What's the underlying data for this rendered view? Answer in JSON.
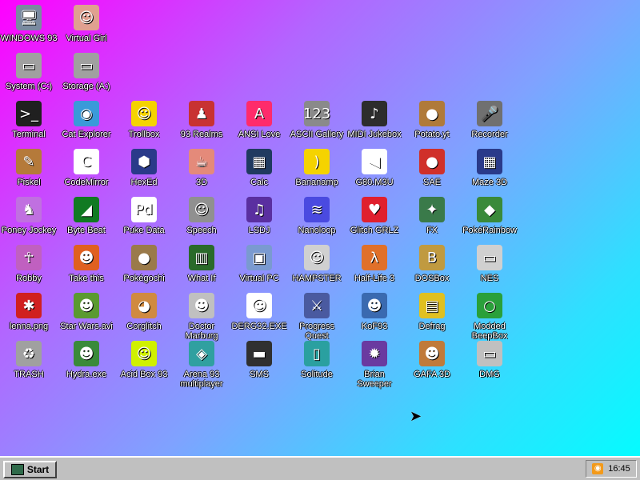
{
  "desktop": {
    "icons": [
      {
        "label": "WINDOWS 93",
        "glyph": "🖥",
        "color": "#7a8aa0"
      },
      {
        "label": "Virtual Girl",
        "glyph": "☺",
        "color": "#e0a090"
      },
      {
        "label": "System (C:)",
        "glyph": "▭",
        "color": "#a0a0a0"
      },
      {
        "label": "Storage (A:)",
        "glyph": "▭",
        "color": "#a0a0a0"
      },
      {
        "label": "Terminal",
        "glyph": ">_",
        "color": "#202020"
      },
      {
        "label": "Cat Explorer",
        "glyph": "◉",
        "color": "#3a9ad9"
      },
      {
        "label": "Trollbox",
        "glyph": "☺",
        "color": "#f5d300"
      },
      {
        "label": "93 Realms",
        "glyph": "♟",
        "color": "#c83232"
      },
      {
        "label": "ANSI Love",
        "glyph": "A",
        "color": "#ff2b6b"
      },
      {
        "label": "ASCII Gallery",
        "glyph": "123",
        "color": "#8a8a8a"
      },
      {
        "label": "MIDI Jukebox",
        "glyph": "♪",
        "color": "#2d2d2d"
      },
      {
        "label": "Potato.yt",
        "glyph": "●",
        "color": "#b07a3a"
      },
      {
        "label": "Recorder",
        "glyph": "🎤",
        "color": "#707070"
      },
      {
        "label": "Piskel",
        "glyph": "✎",
        "color": "#b57a3a"
      },
      {
        "label": "CodeMirror",
        "glyph": "C",
        "color": "#ffffff"
      },
      {
        "label": "HexEd",
        "glyph": "⬢",
        "color": "#2a3a8a"
      },
      {
        "label": "3D",
        "glyph": "☕",
        "color": "#e48a7a"
      },
      {
        "label": "Calc",
        "glyph": "▦",
        "color": "#203a60"
      },
      {
        "label": "Bananamp",
        "glyph": ")",
        "color": "#f5d300"
      },
      {
        "label": "G80.M3U",
        "glyph": "◀",
        "color": "#ffffff"
      },
      {
        "label": "SAE",
        "glyph": "●",
        "color": "#d0302a"
      },
      {
        "label": "Maze 3D",
        "glyph": "▦",
        "color": "#2a3a8a"
      },
      {
        "label": "Poney Jockey",
        "glyph": "♞",
        "color": "#c070e0"
      },
      {
        "label": "Byte Beat",
        "glyph": "◢",
        "color": "#117a22"
      },
      {
        "label": "Puke Data",
        "glyph": "Pd",
        "color": "#ffffff"
      },
      {
        "label": "Speech",
        "glyph": "☺",
        "color": "#909090"
      },
      {
        "label": "LSDJ",
        "glyph": "♫",
        "color": "#5a2fa0"
      },
      {
        "label": "Nanoloop",
        "glyph": "≋",
        "color": "#4a4ae0"
      },
      {
        "label": "Glitch GRLZ",
        "glyph": "♥",
        "color": "#e0202e"
      },
      {
        "label": "FX",
        "glyph": "✦",
        "color": "#3a7a4a"
      },
      {
        "label": "PokéRainbow",
        "glyph": "◆",
        "color": "#3a8a3a"
      },
      {
        "label": "Robby",
        "glyph": "☥",
        "color": "#c060c0"
      },
      {
        "label": "Take this",
        "glyph": "☻",
        "color": "#e06020"
      },
      {
        "label": "Pokégochi",
        "glyph": "●",
        "color": "#9a7a4a"
      },
      {
        "label": "What If",
        "glyph": "▥",
        "color": "#2a6a2a"
      },
      {
        "label": "Virtual PC",
        "glyph": "▣",
        "color": "#7a9ad0"
      },
      {
        "label": "HAMPSTER",
        "glyph": "☺",
        "color": "#d0d0d0"
      },
      {
        "label": "Half-Life 3",
        "glyph": "λ",
        "color": "#e0702a"
      },
      {
        "label": "DOSBox",
        "glyph": "B",
        "color": "#c09a40"
      },
      {
        "label": "NES",
        "glyph": "▭",
        "color": "#d0d0d0"
      },
      {
        "label": "lenna.png",
        "glyph": "✱",
        "color": "#d02020"
      },
      {
        "label": "Star Wars.avi",
        "glyph": "☻",
        "color": "#5a9a30"
      },
      {
        "label": "Corglitch",
        "glyph": "◕",
        "color": "#d08a40"
      },
      {
        "label": "Doctor Marburg",
        "glyph": "☻",
        "color": "#c0c0c0"
      },
      {
        "label": "DERG32.EXE",
        "glyph": "☺",
        "color": "#ffffff"
      },
      {
        "label": "Progress Quest",
        "glyph": "⚔",
        "color": "#4a5aa0"
      },
      {
        "label": "KoF93",
        "glyph": "☻",
        "color": "#3a6ab0"
      },
      {
        "label": "Defrag",
        "glyph": "▤",
        "color": "#e0c020"
      },
      {
        "label": "Modded BeepBox",
        "glyph": "○",
        "color": "#2aa03a"
      },
      {
        "label": "TRASH",
        "glyph": "♻",
        "color": "#a0a0a0"
      },
      {
        "label": "Hydra.exe",
        "glyph": "☻",
        "color": "#3a8a3a"
      },
      {
        "label": "Acid Box 93",
        "glyph": "☺",
        "color": "#d0f000"
      },
      {
        "label": "Arena 93 multiplayer",
        "glyph": "◈",
        "color": "#30a0a0"
      },
      {
        "label": "SMS",
        "glyph": "▬",
        "color": "#303030"
      },
      {
        "label": "Solitude",
        "glyph": "▯",
        "color": "#2aa0a0"
      },
      {
        "label": "Brian Sweeper",
        "glyph": "✹",
        "color": "#6a3aa0"
      },
      {
        "label": "GAFA 3D",
        "glyph": "☻",
        "color": "#c07a3a"
      },
      {
        "label": "DMG",
        "glyph": "▭",
        "color": "#c0c0c0"
      }
    ]
  },
  "taskbar": {
    "start_label": "Start",
    "tray": {
      "time": "16:45",
      "rss_icon": "rss-icon"
    }
  }
}
